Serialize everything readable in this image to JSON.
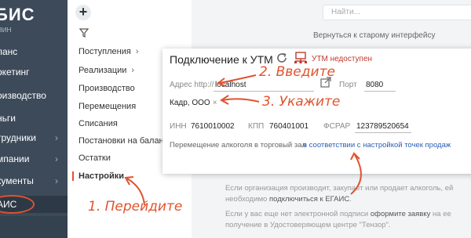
{
  "sidebar": {
    "brand": "БИС",
    "brand_sub": "ЗИН",
    "items": [
      {
        "label": "ланс",
        "chevron": false
      },
      {
        "label": "ркетинг",
        "chevron": false
      },
      {
        "label": "оизводство",
        "chevron": false
      },
      {
        "label": "ньги",
        "chevron": false
      },
      {
        "label": "трудники",
        "chevron": true
      },
      {
        "label": "мпании",
        "chevron": true
      },
      {
        "label": "кументы",
        "chevron": true
      },
      {
        "label": "АИС",
        "chevron": false
      }
    ]
  },
  "menu": {
    "add_label": "+",
    "items": [
      {
        "label": "Поступления",
        "chevron": "›"
      },
      {
        "label": "Реализации",
        "chevron": "›"
      },
      {
        "label": "Производство"
      },
      {
        "label": "Перемещения"
      },
      {
        "label": "Списания"
      },
      {
        "label": "Постановки на баланс"
      },
      {
        "label": "Остатки"
      },
      {
        "label": "Настройки"
      }
    ]
  },
  "search": {
    "placeholder": "Найти..."
  },
  "back_link": "Вернуться к старому интерфейсу",
  "utm": {
    "title": "Подключение к УТМ",
    "status": "УТМ недоступен",
    "address_label": "Адрес http://",
    "address_value": "localhost",
    "port_label": "Порт",
    "port_value": "8080",
    "org_value": "Кадр, ООО",
    "org_remove": "×",
    "inn_label": "ИНН",
    "inn_value": "7610010002",
    "kpp_label": "КПП",
    "kpp_value": "760401001",
    "fsrar_label": "ФСРАР",
    "fsrar_value": "123789520654",
    "transfer_text": "Перемещение алкоголя в торговый зал",
    "transfer_link": "в соответствии с настройкой точек продаж"
  },
  "info": {
    "line1": "Если организация производит, закупает или продает алкоголь, ей",
    "line2_pre": "необходимо",
    "line2_link": "подключиться к ЕГАИС",
    "line2_post": ".",
    "line3_pre": "Если у вас еще нет электронной подписи",
    "line3_link": "оформите заявку",
    "line3_post": "на ее",
    "line4": "получение в Удостоверяющем центре \"Тензор\"."
  },
  "annotations": {
    "step1": "1. Перейдите",
    "step2": "2. Введите",
    "step3": "3. Укажите"
  },
  "colors": {
    "sidebar_bg": "#3c4a5a",
    "accent": "#e0532f",
    "status_error": "#c0392b",
    "link": "#2b5fb3"
  }
}
